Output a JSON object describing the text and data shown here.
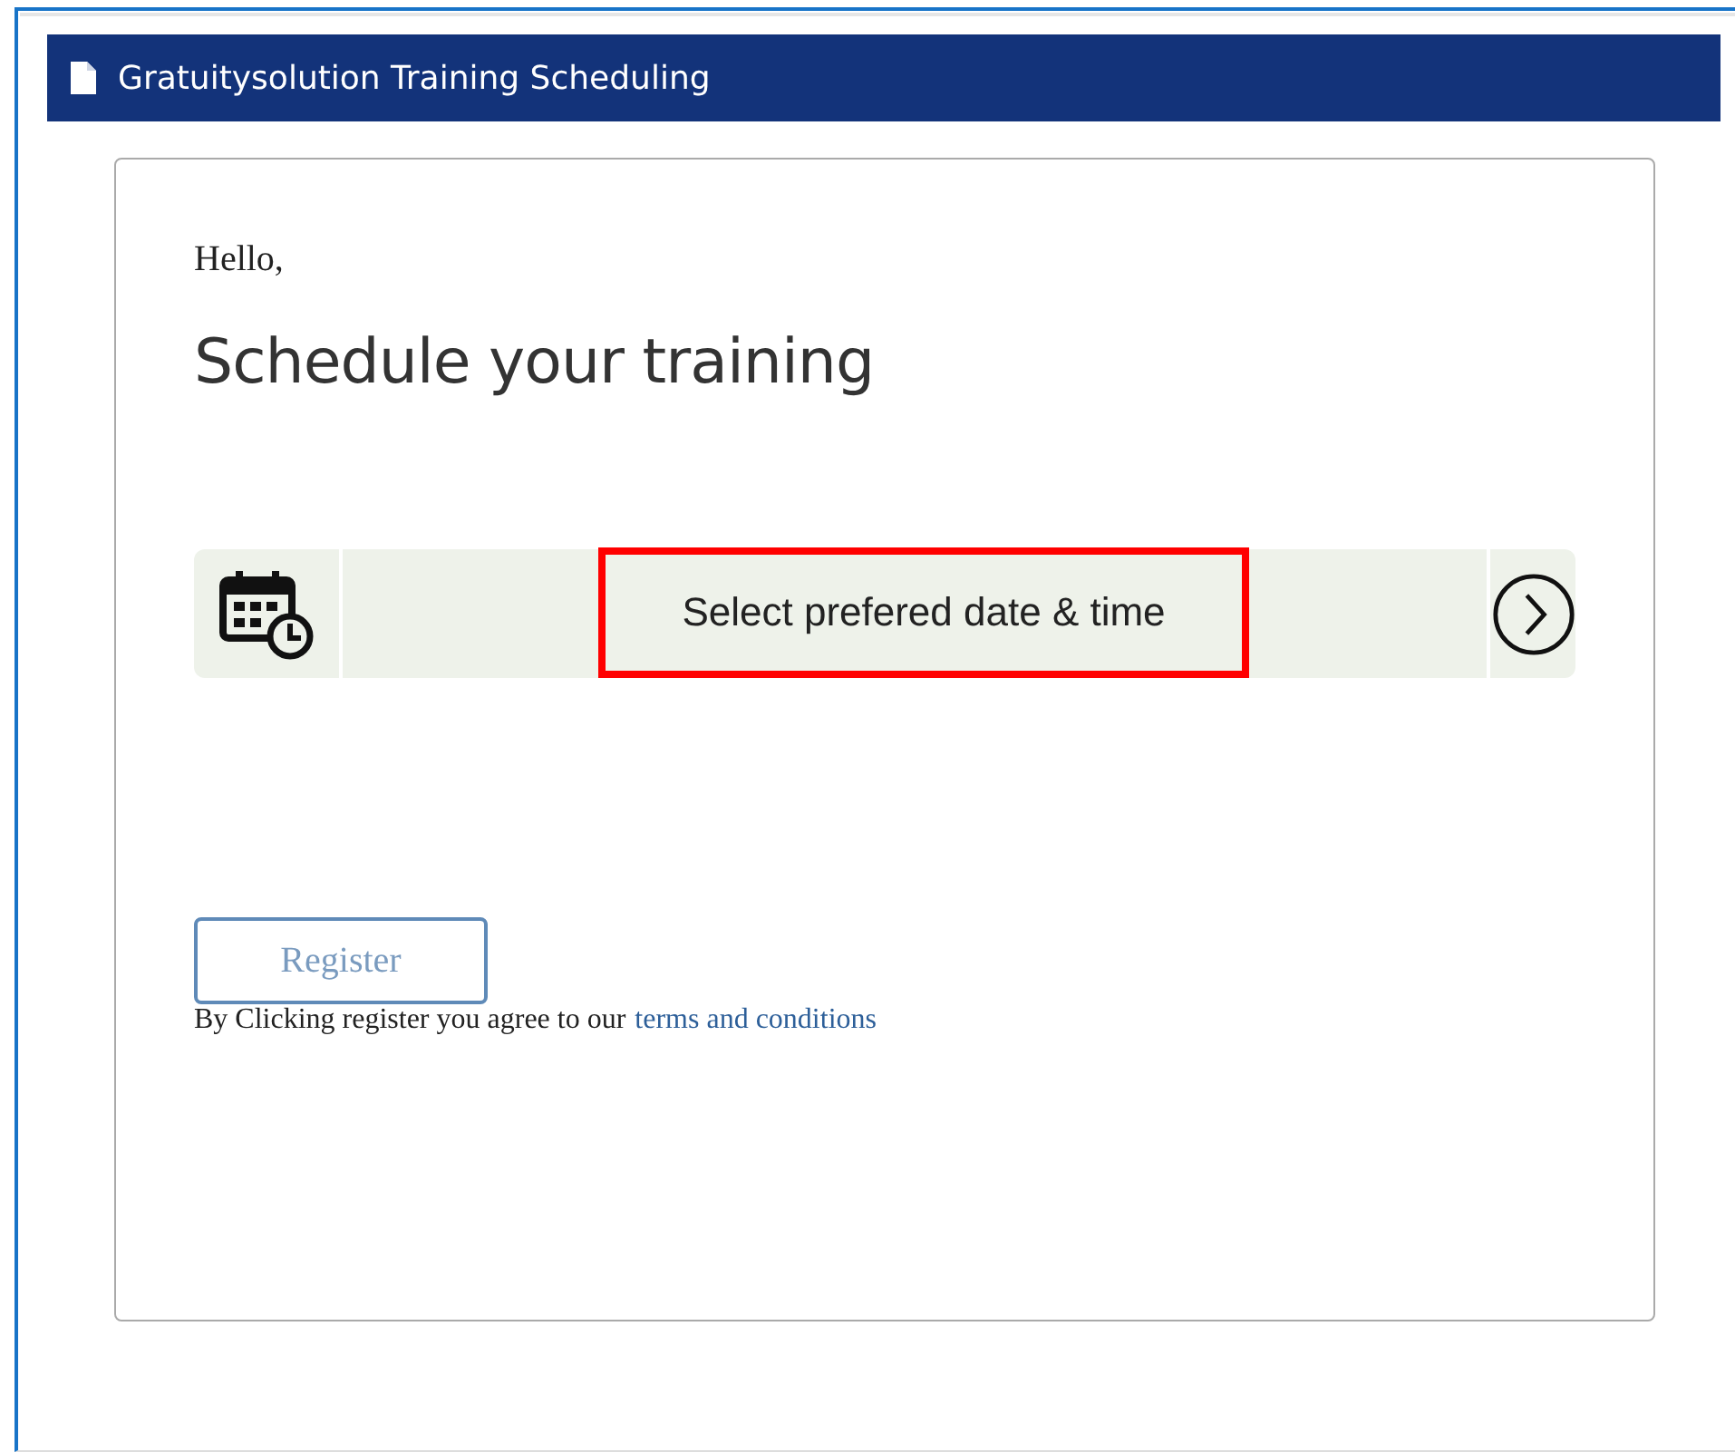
{
  "header": {
    "title": "Gratuitysolution Training Scheduling"
  },
  "card": {
    "greeting": "Hello,",
    "heading": "Schedule your training",
    "date_picker": {
      "label": "Select prefered date & time",
      "highlighted": true
    },
    "register_button": {
      "label": "Register",
      "disabled": true
    },
    "agreement": {
      "text": "By Clicking register you agree to our",
      "link": "terms and conditions"
    }
  }
}
